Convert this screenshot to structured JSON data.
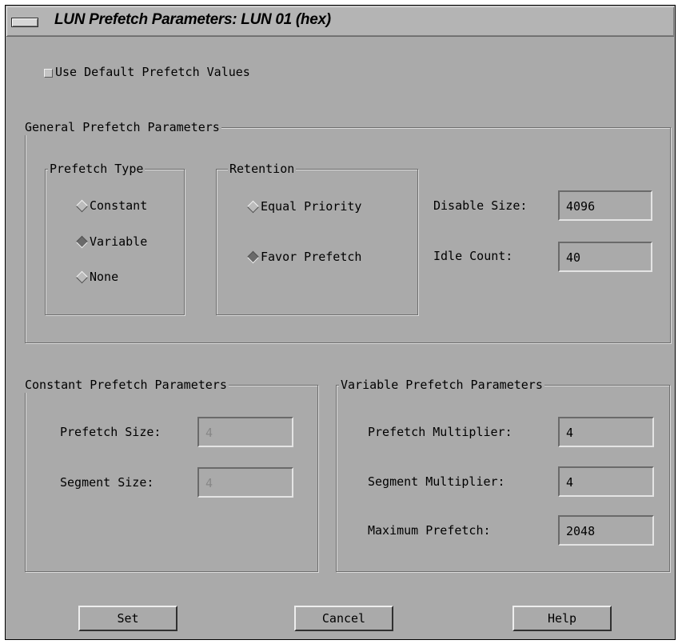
{
  "window": {
    "title": "LUN Prefetch Parameters: LUN 01 (hex)"
  },
  "use_default": {
    "label": "Use Default Prefetch Values",
    "checked": false
  },
  "general": {
    "title": "General Prefetch Parameters",
    "prefetch_type": {
      "title": "Prefetch Type",
      "options": [
        {
          "label": "Constant",
          "selected": false
        },
        {
          "label": "Variable",
          "selected": true
        },
        {
          "label": "None",
          "selected": false
        }
      ]
    },
    "retention": {
      "title": "Retention",
      "options": [
        {
          "label": "Equal Priority",
          "selected": false
        },
        {
          "label": "Favor Prefetch",
          "selected": true
        }
      ]
    },
    "disable_size": {
      "label": "Disable Size:",
      "value": "4096"
    },
    "idle_count": {
      "label": "Idle Count:",
      "value": "40"
    }
  },
  "constant": {
    "title": "Constant Prefetch Parameters",
    "prefetch_size": {
      "label": "Prefetch Size:",
      "value": "4"
    },
    "segment_size": {
      "label": "Segment Size:",
      "value": "4"
    }
  },
  "variable": {
    "title": "Variable Prefetch Parameters",
    "prefetch_multiplier": {
      "label": "Prefetch Multiplier:",
      "value": "4"
    },
    "segment_multiplier": {
      "label": "Segment Multiplier:",
      "value": "4"
    },
    "maximum_prefetch": {
      "label": "Maximum Prefetch:",
      "value": "2048"
    }
  },
  "buttons": {
    "set": "Set",
    "cancel": "Cancel",
    "help": "Help"
  },
  "colors": {
    "background": "#aaaaaa",
    "titlebar": "#b4b4b4"
  }
}
